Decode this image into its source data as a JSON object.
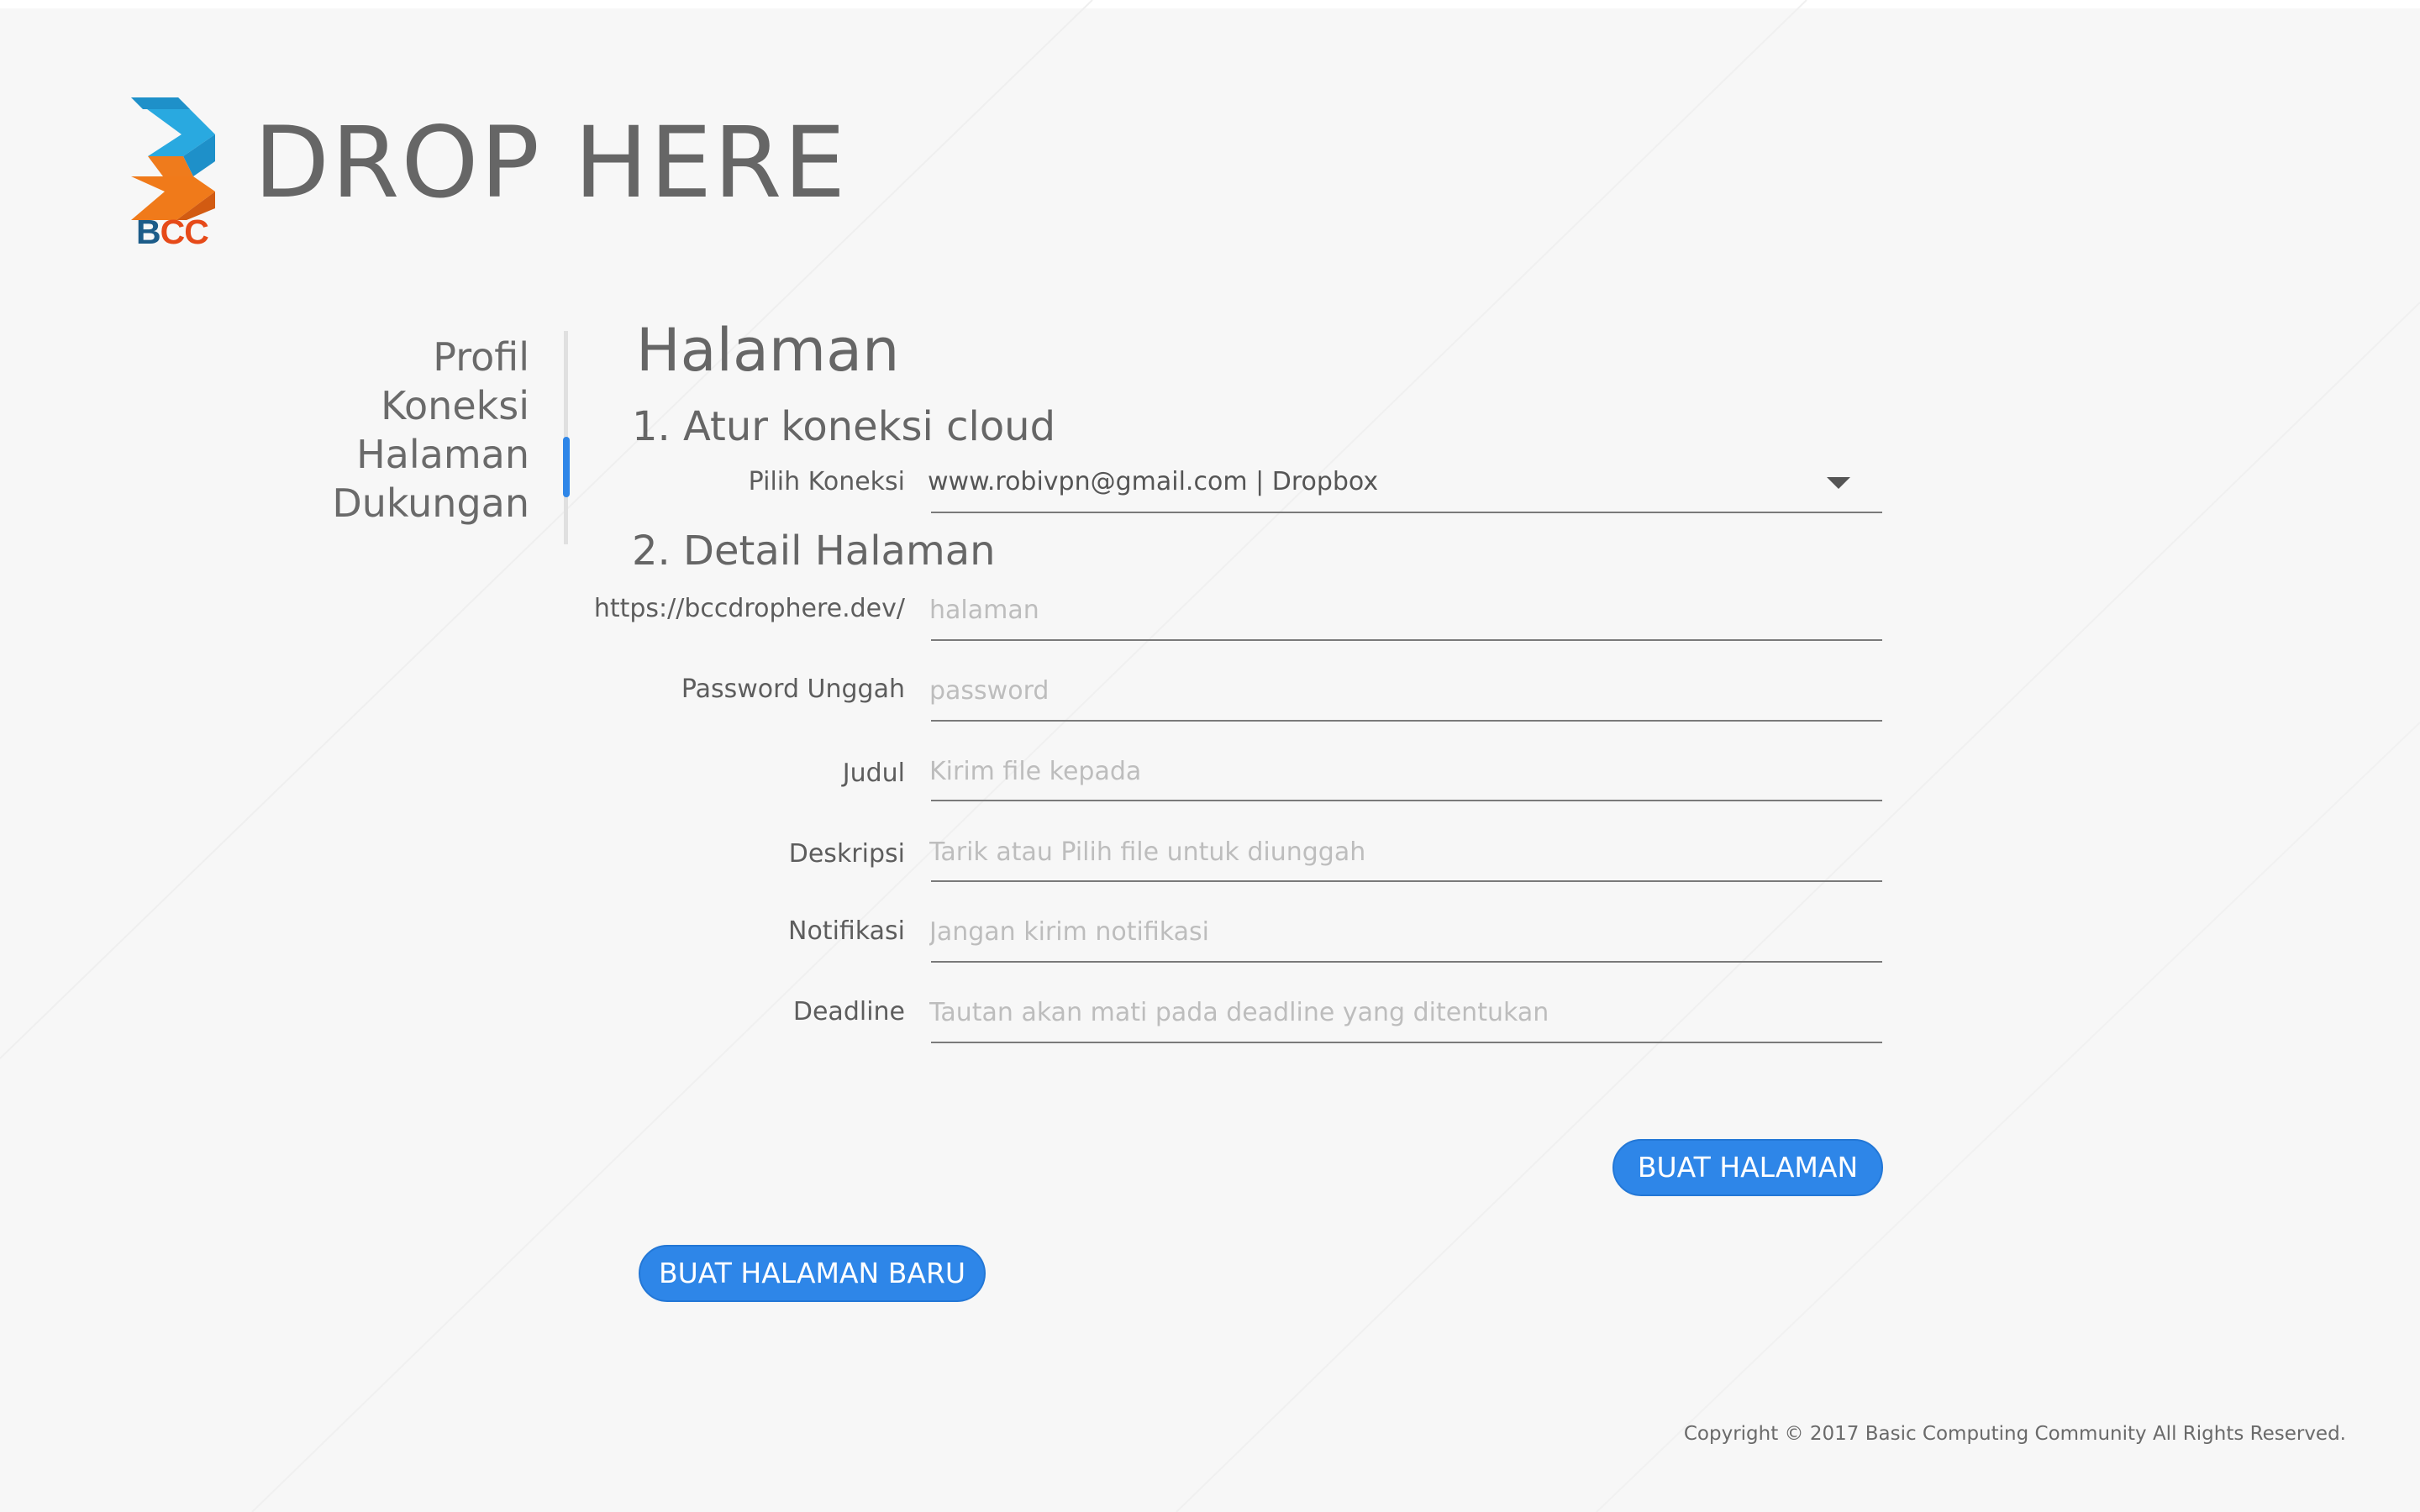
{
  "header": {
    "logo_text_b": "B",
    "logo_text_cc": "CC",
    "app_title": "DROP HERE"
  },
  "nav": {
    "items": [
      {
        "label": "Profil"
      },
      {
        "label": "Koneksi"
      },
      {
        "label": "Halaman"
      },
      {
        "label": "Dukungan"
      }
    ],
    "active_item": "Halaman"
  },
  "main": {
    "title": "Halaman",
    "section1": {
      "heading": "1. Atur koneksi cloud",
      "connection_label": "Pilih Koneksi",
      "connection_value": "www.robivpn@gmail.com | Dropbox"
    },
    "section2": {
      "heading": "2. Detail Halaman",
      "fields": [
        {
          "label": "https://bccdrophere.dev/",
          "placeholder": "halaman",
          "value": ""
        },
        {
          "label": "Password Unggah",
          "placeholder": "password",
          "value": ""
        },
        {
          "label": "Judul",
          "placeholder": "Kirim file kepada",
          "value": ""
        },
        {
          "label": "Deskripsi",
          "placeholder": "Tarik atau Pilih file untuk diunggah",
          "value": ""
        },
        {
          "label": "Notifikasi",
          "placeholder": "Jangan kirim notifikasi",
          "value": ""
        },
        {
          "label": "Deadline",
          "placeholder": "Tautan akan mati pada deadline yang ditentukan",
          "value": ""
        }
      ]
    },
    "create_button": "BUAT HALAMAN",
    "new_page_button": "BUAT HALAMAN BARU"
  },
  "footer": {
    "copyright": "Copyright © 2017 Basic Computing Community All Rights Reserved."
  },
  "colors": {
    "background": "#f7f7f7",
    "accent": "#2e86e8",
    "logo_blue": "#29a9e0",
    "logo_orange": "#f07a1a"
  },
  "icons": {
    "dropdown": "caret-down-icon",
    "logo": "bcc-logo-icon"
  }
}
